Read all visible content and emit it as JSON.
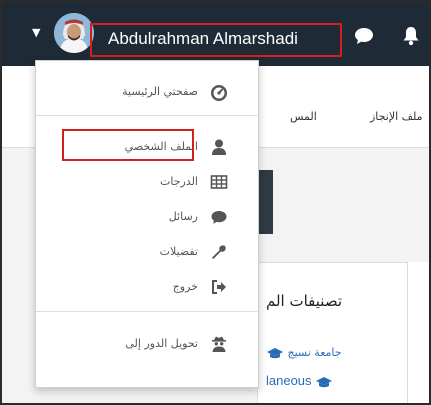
{
  "navbar": {
    "username": "Abdulrahman Almarshadi",
    "avatar_icon": "user-avatar",
    "chat_icon": "chat-bubble-icon",
    "notifications_icon": "bell-icon",
    "caret_icon": "caret-down-icon",
    "highlight_color": "#d0211c",
    "background": "#1e2a35"
  },
  "subnav": {
    "items": [
      "ملف الإنجاز",
      "المس"
    ]
  },
  "card": {
    "title": "تصنيفات الم",
    "links": [
      "جامعة نسيج",
      "laneous"
    ]
  },
  "dropdown": {
    "items": [
      {
        "label": "صفحتي الرئيسية",
        "icon": "dashboard-gauge-icon"
      },
      {
        "label": "الملف الشخصي",
        "icon": "user-icon",
        "highlighted": true
      },
      {
        "label": "الدرجات",
        "icon": "table-grid-icon"
      },
      {
        "label": "رسائل",
        "icon": "message-bubble-icon"
      },
      {
        "label": "تفضيلات",
        "icon": "wrench-icon"
      },
      {
        "label": "خروج",
        "icon": "sign-out-icon"
      },
      {
        "label": "تحويل الدور إلى",
        "icon": "user-secret-icon"
      }
    ]
  }
}
